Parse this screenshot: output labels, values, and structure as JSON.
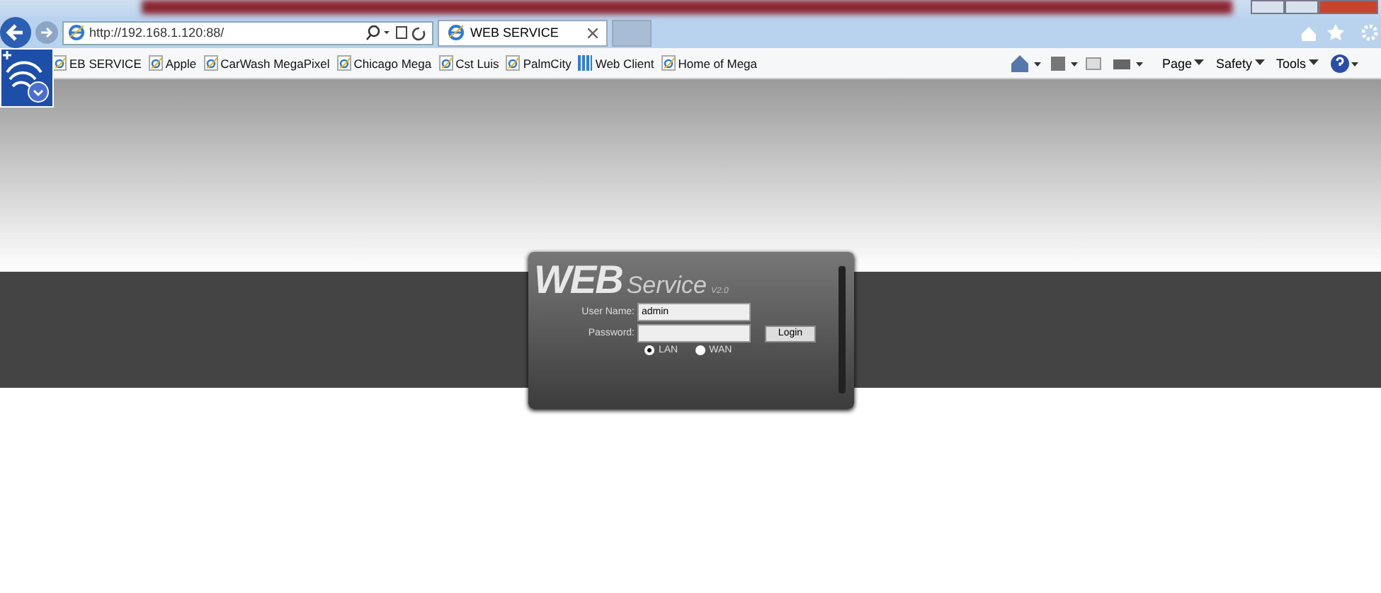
{
  "browser": {
    "address": "http://192.168.1.120:88/",
    "tabs": [
      {
        "title": "WEB SERVICE",
        "selected": true
      }
    ],
    "favorites": [
      {
        "label": "EB SERVICE",
        "kind": "page"
      },
      {
        "label": "Apple",
        "kind": "page"
      },
      {
        "label": "CarWash MegaPixel",
        "kind": "page"
      },
      {
        "label": "Chicago Mega",
        "kind": "page"
      },
      {
        "label": "Cst Luis",
        "kind": "page"
      },
      {
        "label": "PalmCity",
        "kind": "page"
      },
      {
        "label": "Web Client",
        "kind": "app"
      },
      {
        "label": "Home of Mega",
        "kind": "page"
      }
    ],
    "menus": [
      "Page",
      "Safety",
      "Tools"
    ]
  },
  "login": {
    "logo_main": "WEB",
    "logo_sub": "Service",
    "version": "V2.0",
    "fields": [
      {
        "label": "User Name:",
        "value": "admin"
      },
      {
        "label": "Password:"
      }
    ],
    "button": "Login",
    "modes": [
      {
        "label": "LAN",
        "selected": true
      },
      {
        "label": "WAN",
        "selected": false
      }
    ]
  }
}
